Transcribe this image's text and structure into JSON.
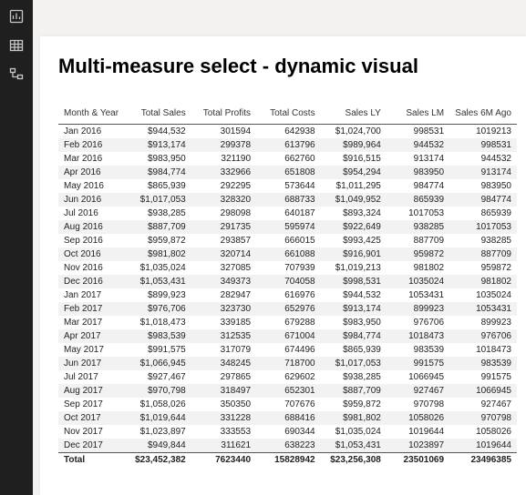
{
  "title": "Multi-measure select - dynamic visual",
  "icons": {
    "report": "report-icon",
    "data": "data-icon",
    "model": "model-icon"
  },
  "chart_data": {
    "type": "table",
    "columns": [
      "Month & Year",
      "Total Sales",
      "Total Profits",
      "Total Costs",
      "Sales LY",
      "Sales LM",
      "Sales 6M Ago"
    ],
    "rows": [
      [
        "Jan 2016",
        "$944,532",
        "301594",
        "642938",
        "$1,024,700",
        "998531",
        "1019213"
      ],
      [
        "Feb 2016",
        "$913,174",
        "299378",
        "613796",
        "$989,964",
        "944532",
        "998531"
      ],
      [
        "Mar 2016",
        "$983,950",
        "321190",
        "662760",
        "$916,515",
        "913174",
        "944532"
      ],
      [
        "Apr 2016",
        "$984,774",
        "332966",
        "651808",
        "$954,294",
        "983950",
        "913174"
      ],
      [
        "May 2016",
        "$865,939",
        "292295",
        "573644",
        "$1,011,295",
        "984774",
        "983950"
      ],
      [
        "Jun 2016",
        "$1,017,053",
        "328320",
        "688733",
        "$1,049,952",
        "865939",
        "984774"
      ],
      [
        "Jul 2016",
        "$938,285",
        "298098",
        "640187",
        "$893,324",
        "1017053",
        "865939"
      ],
      [
        "Aug 2016",
        "$887,709",
        "291735",
        "595974",
        "$922,649",
        "938285",
        "1017053"
      ],
      [
        "Sep 2016",
        "$959,872",
        "293857",
        "666015",
        "$993,425",
        "887709",
        "938285"
      ],
      [
        "Oct 2016",
        "$981,802",
        "320714",
        "661088",
        "$916,901",
        "959872",
        "887709"
      ],
      [
        "Nov 2016",
        "$1,035,024",
        "327085",
        "707939",
        "$1,019,213",
        "981802",
        "959872"
      ],
      [
        "Dec 2016",
        "$1,053,431",
        "349373",
        "704058",
        "$998,531",
        "1035024",
        "981802"
      ],
      [
        "Jan 2017",
        "$899,923",
        "282947",
        "616976",
        "$944,532",
        "1053431",
        "1035024"
      ],
      [
        "Feb 2017",
        "$976,706",
        "323730",
        "652976",
        "$913,174",
        "899923",
        "1053431"
      ],
      [
        "Mar 2017",
        "$1,018,473",
        "339185",
        "679288",
        "$983,950",
        "976706",
        "899923"
      ],
      [
        "Apr 2017",
        "$983,539",
        "312535",
        "671004",
        "$984,774",
        "1018473",
        "976706"
      ],
      [
        "May 2017",
        "$991,575",
        "317079",
        "674496",
        "$865,939",
        "983539",
        "1018473"
      ],
      [
        "Jun 2017",
        "$1,066,945",
        "348245",
        "718700",
        "$1,017,053",
        "991575",
        "983539"
      ],
      [
        "Jul 2017",
        "$927,467",
        "297865",
        "629602",
        "$938,285",
        "1066945",
        "991575"
      ],
      [
        "Aug 2017",
        "$970,798",
        "318497",
        "652301",
        "$887,709",
        "927467",
        "1066945"
      ],
      [
        "Sep 2017",
        "$1,058,026",
        "350350",
        "707676",
        "$959,872",
        "970798",
        "927467"
      ],
      [
        "Oct 2017",
        "$1,019,644",
        "331228",
        "688416",
        "$981,802",
        "1058026",
        "970798"
      ],
      [
        "Nov 2017",
        "$1,023,897",
        "333553",
        "690344",
        "$1,035,024",
        "1019644",
        "1058026"
      ],
      [
        "Dec 2017",
        "$949,844",
        "311621",
        "638223",
        "$1,053,431",
        "1023897",
        "1019644"
      ],
      [
        "Total",
        "$23,452,382",
        "7623440",
        "15828942",
        "$23,256,308",
        "23501069",
        "23496385"
      ]
    ]
  }
}
